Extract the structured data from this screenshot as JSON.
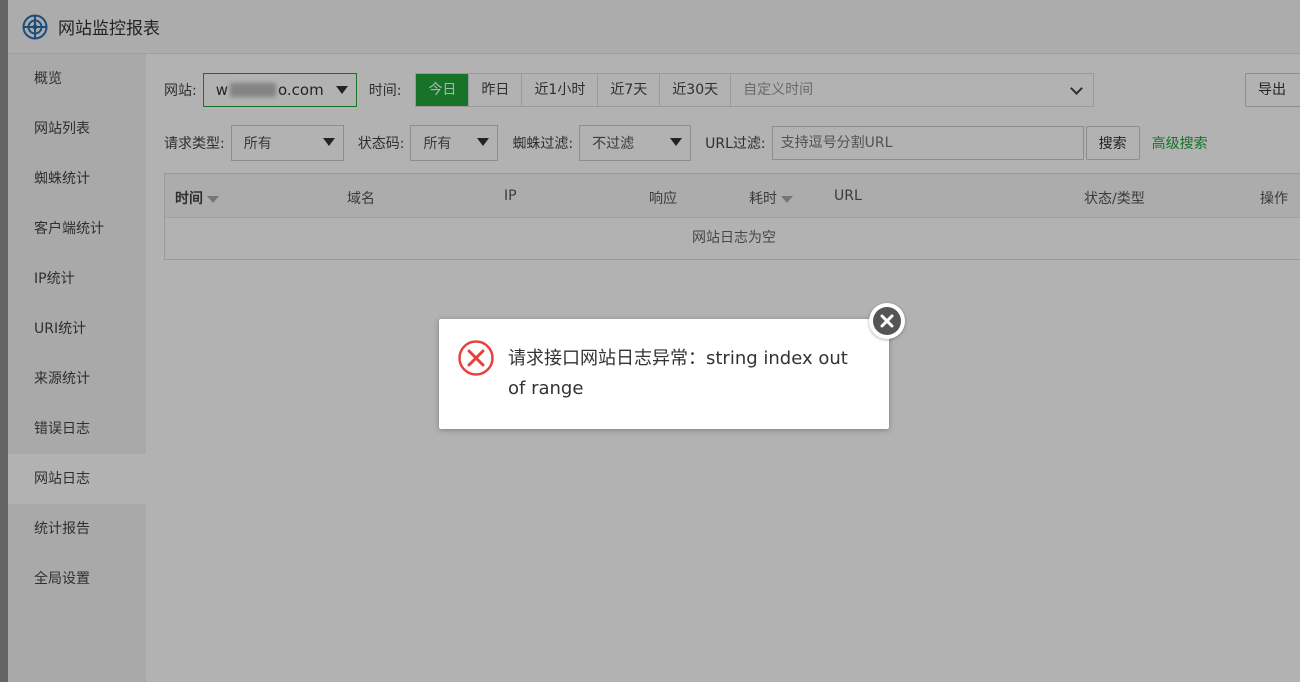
{
  "header": {
    "title": "网站监控报表",
    "logo_icon": "globe-target-icon"
  },
  "sidebar": {
    "items": [
      {
        "label": "概览"
      },
      {
        "label": "网站列表"
      },
      {
        "label": "蜘蛛统计"
      },
      {
        "label": "客户端统计"
      },
      {
        "label": "IP统计"
      },
      {
        "label": "URI统计"
      },
      {
        "label": "来源统计"
      },
      {
        "label": "错误日志"
      },
      {
        "label": "网站日志",
        "active": true
      },
      {
        "label": "统计报告"
      },
      {
        "label": "全局设置"
      }
    ]
  },
  "filters": {
    "site_label": "网站:",
    "site_prefix": "w",
    "site_suffix": "o.com",
    "time_label": "时间:",
    "time_buttons": [
      "今日",
      "昨日",
      "近1小时",
      "近7天",
      "近30天"
    ],
    "time_active": "今日",
    "custom_time_placeholder": "自定义时间",
    "export_label": "导出",
    "request_type_label": "请求类型:",
    "request_type_value": "所有",
    "status_code_label": "状态码:",
    "status_code_value": "所有",
    "spider_filter_label": "蜘蛛过滤:",
    "spider_filter_value": "不过滤",
    "url_filter_label": "URL过滤:",
    "url_filter_placeholder": "支持逗号分割URL",
    "search_label": "搜索",
    "advanced_search_label": "高级搜索"
  },
  "table": {
    "columns": [
      "时间",
      "域名",
      "IP",
      "响应",
      "耗时",
      "URL",
      "状态/类型",
      "操作"
    ],
    "empty_text": "网站日志为空"
  },
  "dialog": {
    "message": "请求接口网站日志异常：string index out of range",
    "icon": "error-circle-icon",
    "close_icon": "close-icon"
  },
  "colors": {
    "accent": "#20a53a",
    "error": "#e8413c"
  }
}
